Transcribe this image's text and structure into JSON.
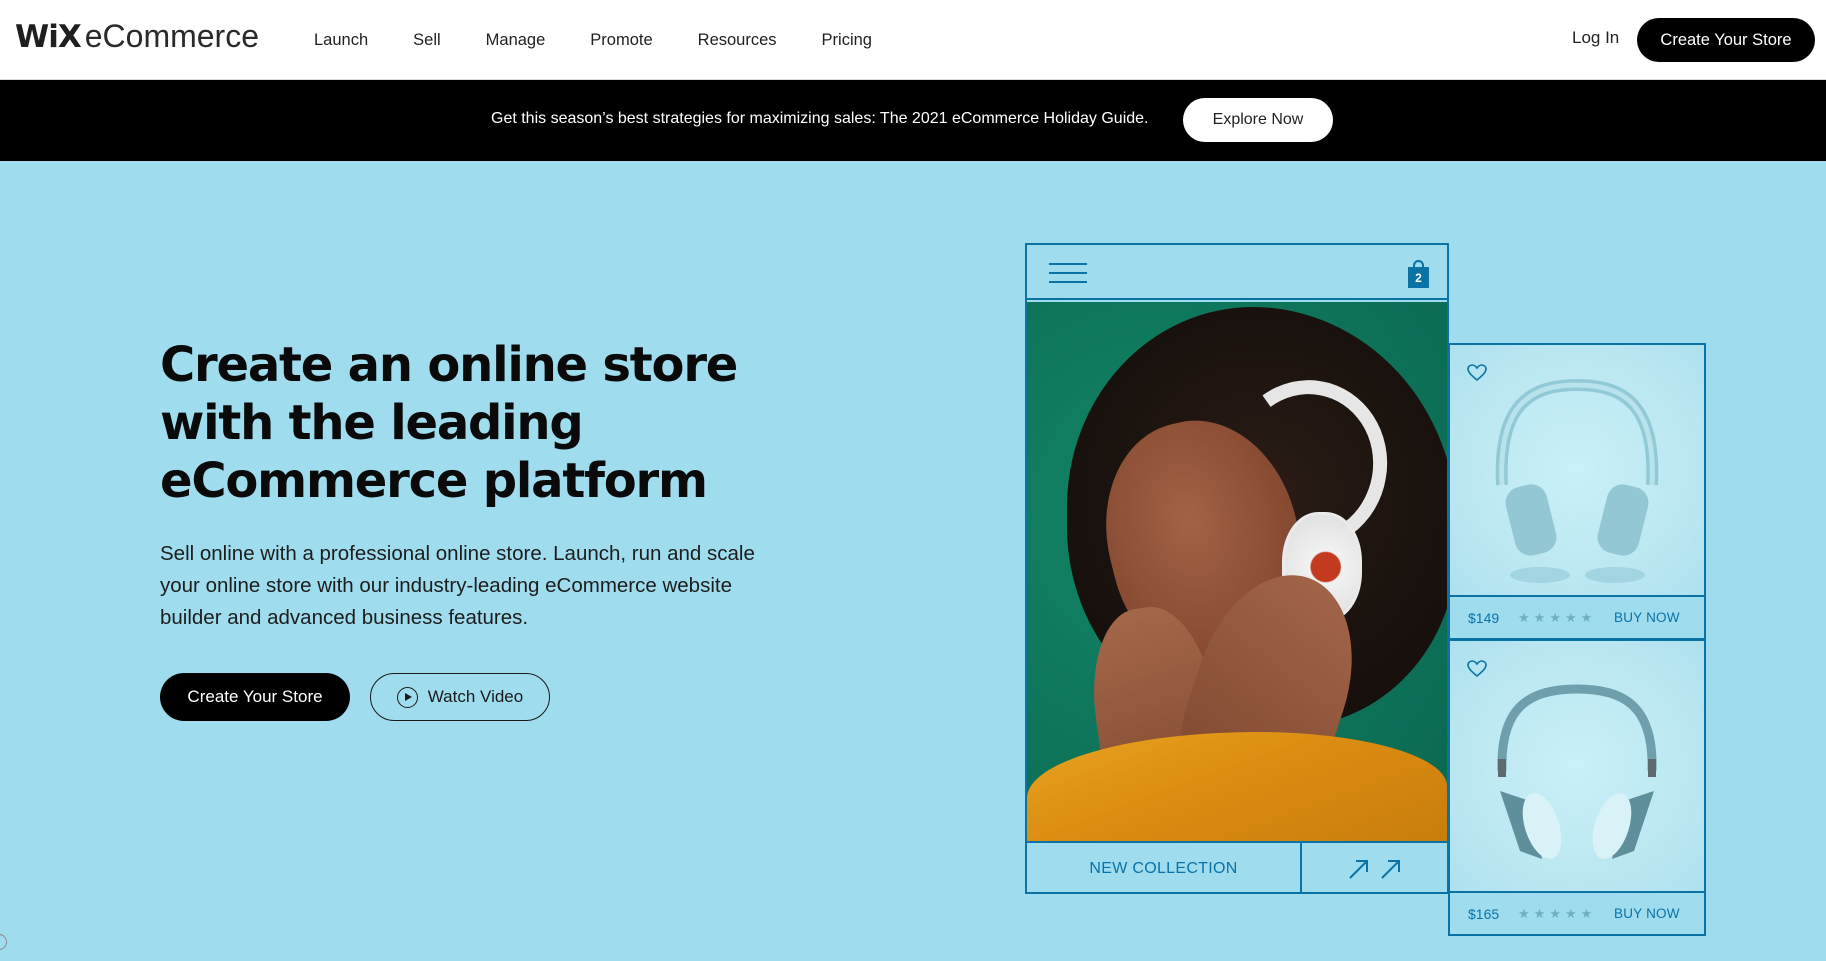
{
  "header": {
    "logo_brand": "WiX",
    "logo_product": "eCommerce",
    "nav": [
      {
        "label": "Launch"
      },
      {
        "label": "Sell"
      },
      {
        "label": "Manage"
      },
      {
        "label": "Promote"
      },
      {
        "label": "Resources"
      },
      {
        "label": "Pricing"
      }
    ],
    "login_label": "Log In",
    "cta_label": "Create Your Store"
  },
  "banner": {
    "text": "Get this season’s best strategies for maximizing sales: The 2021 eCommerce Holiday Guide.",
    "button_label": "Explore Now"
  },
  "hero": {
    "title_lines": [
      "Create an online store",
      "with the leading",
      "eCommerce platform"
    ],
    "description": "Sell online with a professional online store. Launch, run and scale your online store with our industry-leading eCommerce website builder and advanced business features.",
    "primary_cta": "Create Your Store",
    "secondary_cta": "Watch Video",
    "secondary_cta_icon": "play-circle-icon"
  },
  "mockup": {
    "menu_icon": "hamburger-menu-icon",
    "cart_icon": "shopping-bag-icon",
    "cart_count": "2",
    "photo_alt": "Woman wearing white headphones and a yellow sweater on green background",
    "collection_label": "NEW COLLECTION",
    "arrow_icon": "arrow-up-right-icon",
    "products": [
      {
        "price": "$149",
        "rating_stars": 5,
        "buy_label": "BUY NOW",
        "image": "light blue over-ear headphones"
      },
      {
        "price": "$165",
        "rating_stars": 5,
        "buy_label": "BUY NOW",
        "image": "teal on-ear headphones"
      }
    ]
  },
  "colors": {
    "hero_background": "#9edcee",
    "mockup_accent": "#0b72a5",
    "banner_background": "#000000",
    "primary_button": "#000000"
  }
}
